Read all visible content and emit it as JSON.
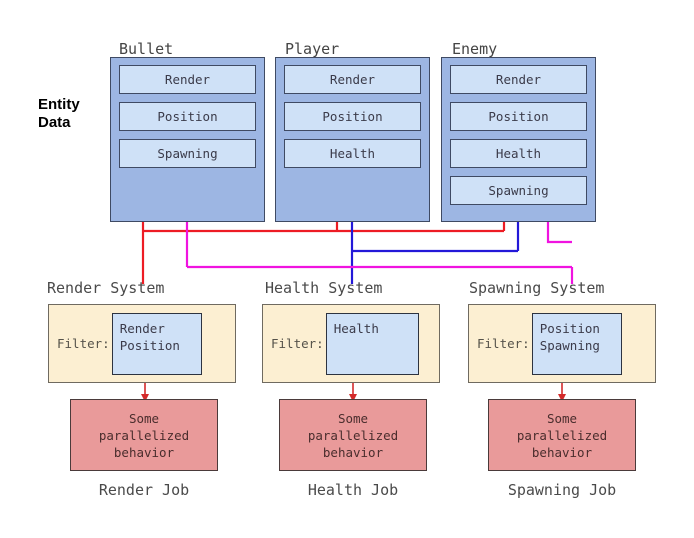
{
  "diagram": {
    "side_label": "Entity\nData",
    "side_label_line1": "Entity",
    "side_label_line2": "Data"
  },
  "entities": [
    {
      "name": "Bullet",
      "components": [
        "Render",
        "Position",
        "Spawning"
      ]
    },
    {
      "name": "Player",
      "components": [
        "Render",
        "Position",
        "Health"
      ]
    },
    {
      "name": "Enemy",
      "components": [
        "Render",
        "Position",
        "Health",
        "Spawning"
      ]
    }
  ],
  "systems": [
    {
      "title": "Render System",
      "filter_label": "Filter:",
      "filter_components": "Render\nPosition",
      "job_text": "Some\nparallelized\nbehavior",
      "job_title": "Render Job",
      "wire_color": "#ED1C24"
    },
    {
      "title": "Health System",
      "filter_label": "Filter:",
      "filter_components": "Health",
      "job_text": "Some\nparallelized\nbehavior",
      "job_title": "Health Job",
      "wire_color": "#2318D8"
    },
    {
      "title": "Spawning System",
      "filter_label": "Filter:",
      "filter_components": "Position\nSpawning",
      "job_text": "Some\nparallelized\nbehavior",
      "job_title": "Spawning Job",
      "wire_color": "#F013E0"
    }
  ],
  "colors": {
    "entity_box_fill": "#9DB6E3",
    "component_fill": "#CFE1F7",
    "system_fill": "#FCEFD2",
    "job_fill": "#E99A9A",
    "render_wire": "#ED1C24",
    "health_wire": "#2318D8",
    "spawning_wire": "#F013E0",
    "arrow": "#D42A2A"
  }
}
